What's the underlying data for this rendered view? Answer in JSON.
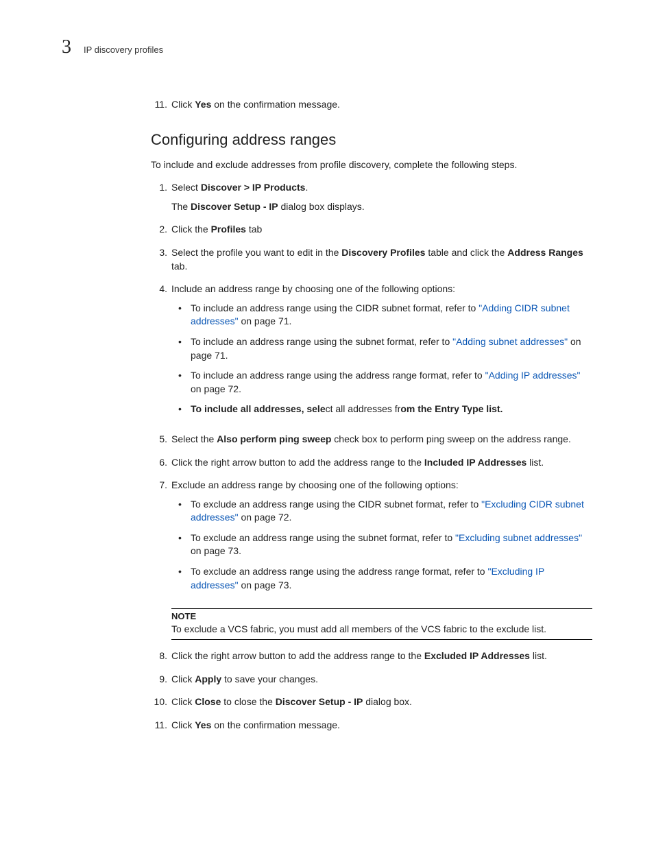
{
  "header": {
    "chapter_number": "3",
    "running_head": "IP discovery profiles"
  },
  "pre_step": {
    "num": "11.",
    "text_a": "Click ",
    "bold": "Yes",
    "text_b": " on the confirmation message."
  },
  "heading": "Configuring address ranges",
  "intro": "To include and exclude addresses from profile discovery, complete the following steps.",
  "steps": {
    "s1": {
      "num": "1.",
      "a": "Select ",
      "b": "Discover > IP Products",
      "c": ".",
      "sub_a": "The ",
      "sub_b": "Discover Setup - IP",
      "sub_c": " dialog box displays."
    },
    "s2": {
      "num": "2.",
      "a": "Click the ",
      "b": "Profiles",
      "c": " tab"
    },
    "s3": {
      "num": "3.",
      "a": "Select the profile you want to edit in the ",
      "b": "Discovery Profiles",
      "c": " table and click the ",
      "d": "Address Ranges",
      "e": " tab."
    },
    "s4": {
      "num": "4.",
      "text": "Include an address range by choosing one of the following options:",
      "b1_a": "To include an address range using the CIDR subnet format, refer to ",
      "b1_link": "\"Adding CIDR subnet addresses\"",
      "b1_b": " on page 71.",
      "b2_a": "To include an address range using the subnet format, refer to ",
      "b2_link": "\"Adding subnet addresses\"",
      "b2_b": " on page 71.",
      "b3_a": "To include an address range using the address range format, refer to ",
      "b3_link": "\"Adding IP addresses\"",
      "b3_b": " on page 72.",
      "b4_a": "To include all addresses, sele",
      "b4_mid": "ct all addresses fr",
      "b4_b": "om the Entry Type list."
    },
    "s5": {
      "num": "5.",
      "a": "Select the ",
      "b": "Also perform ping sweep",
      "c": " check box to perform ping sweep on the address range."
    },
    "s6": {
      "num": "6.",
      "a": "Click the right arrow button to add the address range to the ",
      "b": "Included IP Addresses",
      "c": " list."
    },
    "s7": {
      "num": "7.",
      "text": "Exclude an address range by choosing one of the following options:",
      "b1_a": "To exclude an address range using the CIDR subnet format, refer to ",
      "b1_link": "\"Excluding CIDR subnet addresses\"",
      "b1_b": " on page 72.",
      "b2_a": "To exclude an address range using the subnet format, refer to ",
      "b2_link": "\"Excluding subnet addresses\"",
      "b2_b": " on page 73.",
      "b3_a": "To exclude an address range using the address range format, refer to ",
      "b3_link": "\"Excluding IP addresses\"",
      "b3_b": " on page 73."
    },
    "note": {
      "label": "NOTE",
      "text": "To exclude a VCS fabric, you must add all members of the VCS fabric to the exclude list."
    },
    "s8": {
      "num": "8.",
      "a": "Click the right arrow button to add the address range to the ",
      "b": "Excluded IP Addresses",
      "c": " list."
    },
    "s9": {
      "num": "9.",
      "a": "Click ",
      "b": "Apply",
      "c": " to save your changes."
    },
    "s10": {
      "num": "10.",
      "a": "Click ",
      "b": "Close",
      "c": " to close the ",
      "d": "Discover Setup - IP",
      "e": " dialog box."
    },
    "s11": {
      "num": "11.",
      "a": "Click ",
      "b": "Yes",
      "c": " on the confirmation message."
    }
  }
}
